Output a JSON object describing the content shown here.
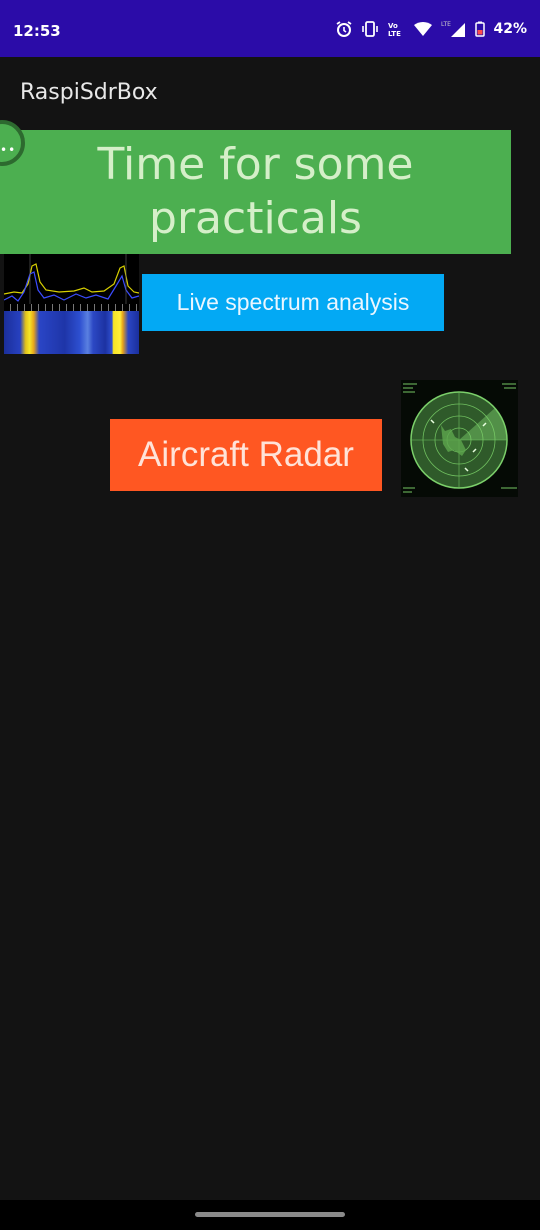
{
  "status_bar": {
    "time": "12:53",
    "battery_percent": "42%",
    "network_label": "LTE",
    "icons": [
      "alarm-icon",
      "vibrate-icon",
      "volte-icon",
      "wifi-icon",
      "signal-icon",
      "battery-icon"
    ]
  },
  "app_bar": {
    "title": "RaspiSdrBox"
  },
  "banner": {
    "text": "Time for some practicals"
  },
  "buttons": {
    "spectrum_label": "Live spectrum analysis",
    "radar_label": "Aircraft Radar"
  },
  "colors": {
    "status_bar": "#2b0ca8",
    "background": "#131313",
    "banner": "#4caf50",
    "spectrum_button": "#03a9f4",
    "radar_button": "#ff5722"
  }
}
